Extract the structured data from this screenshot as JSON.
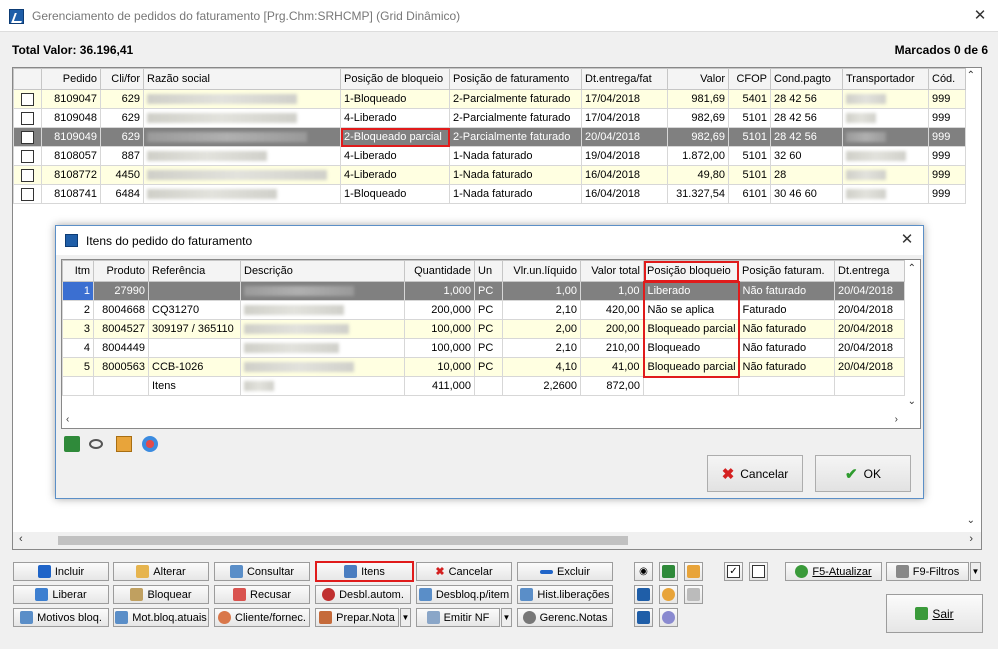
{
  "window": {
    "title": "Gerenciamento de pedidos do faturamento [Prg.Chm:SRHCMP] (Grid Dinâmico)"
  },
  "summary": {
    "total_valor": "Total Valor: 36.196,41",
    "marcados": "Marcados 0 de 6"
  },
  "orders_grid": {
    "columns": [
      "",
      "Pedido",
      "Cli/for",
      "Razão social",
      "Posição de bloqueio",
      "Posição de faturamento",
      "Dt.entrega/fat",
      "Valor",
      "CFOP",
      "Cond.pagto",
      "Transportador",
      "Cód."
    ],
    "rows": [
      {
        "pedido": "8109047",
        "clifor": "629",
        "bloqueio": "1-Bloqueado",
        "faturamento": "2-Parcialmente faturado",
        "dt": "17/04/2018",
        "valor": "981,69",
        "cfop": "5401",
        "cond": "28 42 56",
        "cod": "999"
      },
      {
        "pedido": "8109048",
        "clifor": "629",
        "bloqueio": "4-Liberado",
        "faturamento": "2-Parcialmente faturado",
        "dt": "17/04/2018",
        "valor": "982,69",
        "cfop": "5101",
        "cond": "28 42 56",
        "cod": "999"
      },
      {
        "pedido": "8109049",
        "clifor": "629",
        "bloqueio": "2-Bloqueado parcial",
        "faturamento": "2-Parcialmente faturado",
        "dt": "20/04/2018",
        "valor": "982,69",
        "cfop": "5101",
        "cond": "28 42 56",
        "cod": "999"
      },
      {
        "pedido": "8108057",
        "clifor": "887",
        "bloqueio": "4-Liberado",
        "faturamento": "1-Nada faturado",
        "dt": "19/04/2018",
        "valor": "1.872,00",
        "cfop": "5101",
        "cond": "32 60",
        "cod": "999"
      },
      {
        "pedido": "8108772",
        "clifor": "4450",
        "bloqueio": "4-Liberado",
        "faturamento": "1-Nada faturado",
        "dt": "16/04/2018",
        "valor": "49,80",
        "cfop": "5101",
        "cond": "28",
        "cod": "999"
      },
      {
        "pedido": "8108741",
        "clifor": "6484",
        "bloqueio": "1-Bloqueado",
        "faturamento": "1-Nada faturado",
        "dt": "16/04/2018",
        "valor": "31.327,54",
        "cfop": "6101",
        "cond": "30 46 60",
        "cod": "999"
      }
    ]
  },
  "items_dialog": {
    "title": "Itens do pedido do faturamento",
    "columns": [
      "Itm",
      "Produto",
      "Referência",
      "Descrição",
      "Quantidade",
      "Un",
      "Vlr.un.líquido",
      "Valor total",
      "Posição bloqueio",
      "Posição faturam.",
      "Dt.entrega"
    ],
    "rows": [
      {
        "itm": "1",
        "produto": "27990",
        "ref": "",
        "qtd": "1,000",
        "un": "PC",
        "vlr": "1,00",
        "total": "1,00",
        "bloqueio": "Liberado",
        "fat": "Não faturado",
        "dt": "20/04/2018"
      },
      {
        "itm": "2",
        "produto": "8004668",
        "ref": "CQ31270",
        "qtd": "200,000",
        "un": "PC",
        "vlr": "2,10",
        "total": "420,00",
        "bloqueio": "Não se aplica",
        "fat": "Faturado",
        "dt": "20/04/2018"
      },
      {
        "itm": "3",
        "produto": "8004527",
        "ref": "309197 / 365110",
        "qtd": "100,000",
        "un": "PC",
        "vlr": "2,00",
        "total": "200,00",
        "bloqueio": "Bloqueado parcial",
        "fat": "Não faturado",
        "dt": "20/04/2018"
      },
      {
        "itm": "4",
        "produto": "8004449",
        "ref": "",
        "qtd": "100,000",
        "un": "PC",
        "vlr": "2,10",
        "total": "210,00",
        "bloqueio": "Bloqueado",
        "fat": "Não faturado",
        "dt": "20/04/2018"
      },
      {
        "itm": "5",
        "produto": "8000563",
        "ref": "CCB-1026",
        "qtd": "10,000",
        "un": "PC",
        "vlr": "4,10",
        "total": "41,00",
        "bloqueio": "Bloqueado parcial",
        "fat": "Não faturado",
        "dt": "20/04/2018"
      }
    ],
    "footer": {
      "label": "Itens",
      "qtd": "411,000",
      "vlr": "2,2600",
      "total": "872,00"
    },
    "cancel_label": "Cancelar",
    "ok_label": "OK"
  },
  "toolbar": {
    "incluir": "Incluir",
    "alterar": "Alterar",
    "consultar": "Consultar",
    "itens": "Itens",
    "cancelar": "Cancelar",
    "excluir": "Excluir",
    "liberar": "Liberar",
    "bloquear": "Bloquear",
    "recusar": "Recusar",
    "desbl_autom": "Desbl.autom.",
    "desbloq_item": "Desbloq.p/item",
    "hist_liberacoes": "Hist.liberações",
    "motivos_bloq": "Motivos bloq.",
    "mot_bloq_atuais": "Mot.bloq.atuais",
    "cliente_fornec": "Cliente/fornec.",
    "prepar_nota": "Prepar.Nota",
    "emitir_nf": "Emitir NF",
    "gerenc_notas": "Gerenc.Notas",
    "f5_atualizar": "F5-Atualizar",
    "f9_filtros": "F9-Filtros",
    "sair": "Sair"
  },
  "colors": {
    "cream_row": "#ffffe1",
    "selected_row": "#808080",
    "highlight_box": "#e01b1b"
  }
}
